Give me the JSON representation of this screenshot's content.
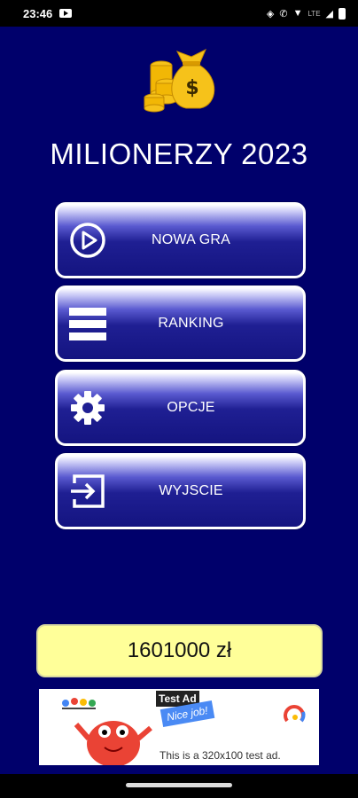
{
  "status_bar": {
    "time": "23:46",
    "network": "LTE"
  },
  "app": {
    "title": "MILIONERZY 2023",
    "logo_icon": "money-bag-coins-icon"
  },
  "menu": [
    {
      "label": "NOWA GRA",
      "icon": "play-circle-icon"
    },
    {
      "label": "RANKING",
      "icon": "list-icon"
    },
    {
      "label": "OPCJE",
      "icon": "gear-icon"
    },
    {
      "label": "WYJSCIE",
      "icon": "exit-icon"
    }
  ],
  "score": {
    "value": "1601000 zł"
  },
  "ad": {
    "tag": "Test Ad",
    "badge": "Nice job!",
    "text": "This is a 320x100 test ad."
  },
  "colors": {
    "background": "#00006b",
    "score_bg": "#ffff99",
    "button_dark": "#141480"
  }
}
